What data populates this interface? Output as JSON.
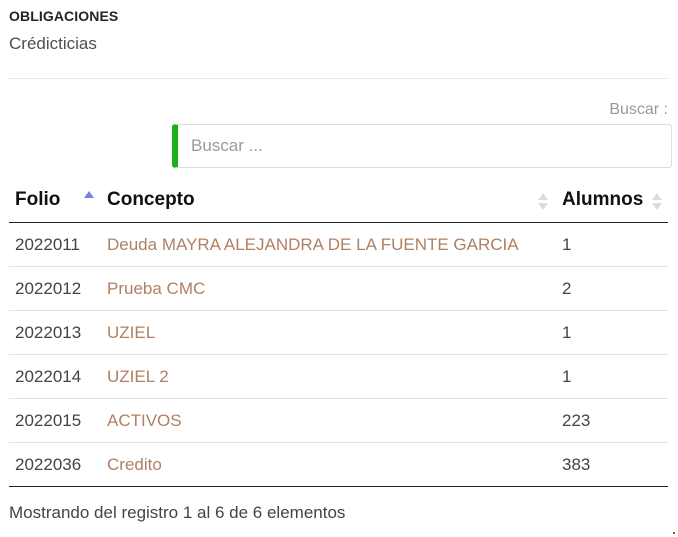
{
  "header": {
    "title": "OBLIGACIONES",
    "subtitle": "Crédicticias"
  },
  "search": {
    "label": "Buscar :",
    "placeholder": "Buscar ...",
    "value": ""
  },
  "table": {
    "columns": {
      "folio": "Folio",
      "concepto": "Concepto",
      "alumnos": "Alumnos"
    },
    "sort": {
      "column": "folio",
      "direction": "asc"
    },
    "rows": [
      {
        "folio": "2022011",
        "concepto": "Deuda MAYRA ALEJANDRA DE LA FUENTE GARCIA",
        "alumnos": "1"
      },
      {
        "folio": "2022012",
        "concepto": "Prueba CMC",
        "alumnos": "2"
      },
      {
        "folio": "2022013",
        "concepto": "UZIEL",
        "alumnos": "1"
      },
      {
        "folio": "2022014",
        "concepto": "UZIEL 2",
        "alumnos": "1"
      },
      {
        "folio": "2022015",
        "concepto": "ACTIVOS",
        "alumnos": "223"
      },
      {
        "folio": "2022036",
        "concepto": "Credito",
        "alumnos": "383"
      }
    ]
  },
  "footer": {
    "info": "Mostrando del registro 1 al 6 de 6 elementos"
  },
  "colors": {
    "accent_border": "#1cb01c",
    "link": "#b08062",
    "sort_active": "#7b7fe0"
  }
}
